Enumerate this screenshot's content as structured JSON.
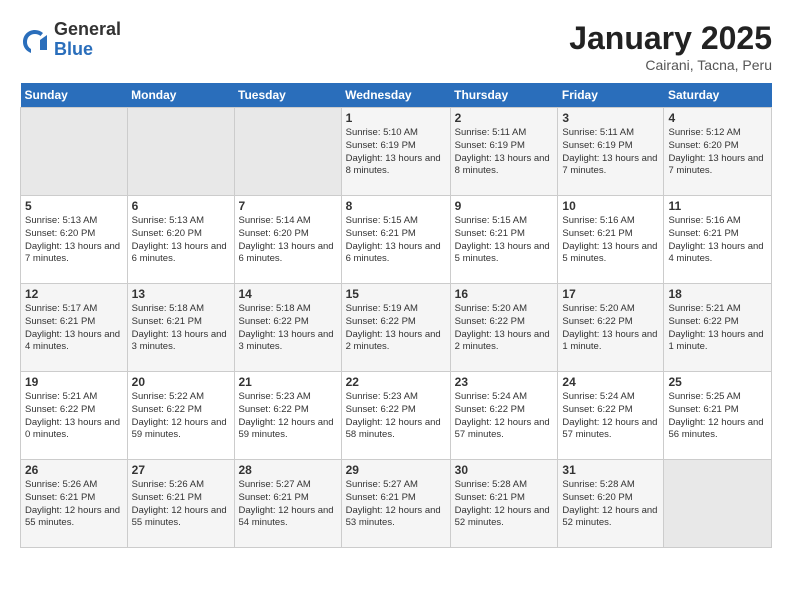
{
  "header": {
    "logo_general": "General",
    "logo_blue": "Blue",
    "month_title": "January 2025",
    "location": "Cairani, Tacna, Peru"
  },
  "weekdays": [
    "Sunday",
    "Monday",
    "Tuesday",
    "Wednesday",
    "Thursday",
    "Friday",
    "Saturday"
  ],
  "weeks": [
    [
      {
        "day": "",
        "empty": true
      },
      {
        "day": "",
        "empty": true
      },
      {
        "day": "",
        "empty": true
      },
      {
        "day": "1",
        "sunrise": "5:10 AM",
        "sunset": "6:19 PM",
        "daylight": "13 hours and 8 minutes."
      },
      {
        "day": "2",
        "sunrise": "5:11 AM",
        "sunset": "6:19 PM",
        "daylight": "13 hours and 8 minutes."
      },
      {
        "day": "3",
        "sunrise": "5:11 AM",
        "sunset": "6:19 PM",
        "daylight": "13 hours and 7 minutes."
      },
      {
        "day": "4",
        "sunrise": "5:12 AM",
        "sunset": "6:20 PM",
        "daylight": "13 hours and 7 minutes."
      }
    ],
    [
      {
        "day": "5",
        "sunrise": "5:13 AM",
        "sunset": "6:20 PM",
        "daylight": "13 hours and 7 minutes."
      },
      {
        "day": "6",
        "sunrise": "5:13 AM",
        "sunset": "6:20 PM",
        "daylight": "13 hours and 6 minutes."
      },
      {
        "day": "7",
        "sunrise": "5:14 AM",
        "sunset": "6:20 PM",
        "daylight": "13 hours and 6 minutes."
      },
      {
        "day": "8",
        "sunrise": "5:15 AM",
        "sunset": "6:21 PM",
        "daylight": "13 hours and 6 minutes."
      },
      {
        "day": "9",
        "sunrise": "5:15 AM",
        "sunset": "6:21 PM",
        "daylight": "13 hours and 5 minutes."
      },
      {
        "day": "10",
        "sunrise": "5:16 AM",
        "sunset": "6:21 PM",
        "daylight": "13 hours and 5 minutes."
      },
      {
        "day": "11",
        "sunrise": "5:16 AM",
        "sunset": "6:21 PM",
        "daylight": "13 hours and 4 minutes."
      }
    ],
    [
      {
        "day": "12",
        "sunrise": "5:17 AM",
        "sunset": "6:21 PM",
        "daylight": "13 hours and 4 minutes."
      },
      {
        "day": "13",
        "sunrise": "5:18 AM",
        "sunset": "6:21 PM",
        "daylight": "13 hours and 3 minutes."
      },
      {
        "day": "14",
        "sunrise": "5:18 AM",
        "sunset": "6:22 PM",
        "daylight": "13 hours and 3 minutes."
      },
      {
        "day": "15",
        "sunrise": "5:19 AM",
        "sunset": "6:22 PM",
        "daylight": "13 hours and 2 minutes."
      },
      {
        "day": "16",
        "sunrise": "5:20 AM",
        "sunset": "6:22 PM",
        "daylight": "13 hours and 2 minutes."
      },
      {
        "day": "17",
        "sunrise": "5:20 AM",
        "sunset": "6:22 PM",
        "daylight": "13 hours and 1 minute."
      },
      {
        "day": "18",
        "sunrise": "5:21 AM",
        "sunset": "6:22 PM",
        "daylight": "13 hours and 1 minute."
      }
    ],
    [
      {
        "day": "19",
        "sunrise": "5:21 AM",
        "sunset": "6:22 PM",
        "daylight": "13 hours and 0 minutes."
      },
      {
        "day": "20",
        "sunrise": "5:22 AM",
        "sunset": "6:22 PM",
        "daylight": "12 hours and 59 minutes."
      },
      {
        "day": "21",
        "sunrise": "5:23 AM",
        "sunset": "6:22 PM",
        "daylight": "12 hours and 59 minutes."
      },
      {
        "day": "22",
        "sunrise": "5:23 AM",
        "sunset": "6:22 PM",
        "daylight": "12 hours and 58 minutes."
      },
      {
        "day": "23",
        "sunrise": "5:24 AM",
        "sunset": "6:22 PM",
        "daylight": "12 hours and 57 minutes."
      },
      {
        "day": "24",
        "sunrise": "5:24 AM",
        "sunset": "6:22 PM",
        "daylight": "12 hours and 57 minutes."
      },
      {
        "day": "25",
        "sunrise": "5:25 AM",
        "sunset": "6:21 PM",
        "daylight": "12 hours and 56 minutes."
      }
    ],
    [
      {
        "day": "26",
        "sunrise": "5:26 AM",
        "sunset": "6:21 PM",
        "daylight": "12 hours and 55 minutes."
      },
      {
        "day": "27",
        "sunrise": "5:26 AM",
        "sunset": "6:21 PM",
        "daylight": "12 hours and 55 minutes."
      },
      {
        "day": "28",
        "sunrise": "5:27 AM",
        "sunset": "6:21 PM",
        "daylight": "12 hours and 54 minutes."
      },
      {
        "day": "29",
        "sunrise": "5:27 AM",
        "sunset": "6:21 PM",
        "daylight": "12 hours and 53 minutes."
      },
      {
        "day": "30",
        "sunrise": "5:28 AM",
        "sunset": "6:21 PM",
        "daylight": "12 hours and 52 minutes."
      },
      {
        "day": "31",
        "sunrise": "5:28 AM",
        "sunset": "6:20 PM",
        "daylight": "12 hours and 52 minutes."
      },
      {
        "day": "",
        "empty": true
      }
    ]
  ]
}
